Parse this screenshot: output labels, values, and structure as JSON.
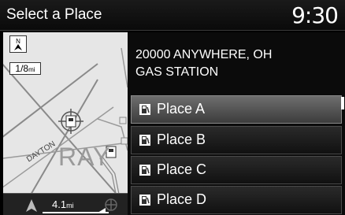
{
  "header": {
    "title": "Select a Place",
    "clock": "9:30"
  },
  "map": {
    "scale_value": "1/8",
    "scale_unit": "mi",
    "distance_value": "4.1",
    "distance_unit": "mi",
    "road_label": "DAYTON",
    "map_watermark": "RAY"
  },
  "selection": {
    "address_line1": "20000 ANYWHERE, OH",
    "address_line2": "GAS STATION"
  },
  "places": [
    {
      "label": "Place A",
      "icon": "gas-station-icon",
      "selected": true
    },
    {
      "label": "Place B",
      "icon": "gas-station-icon",
      "selected": false
    },
    {
      "label": "Place C",
      "icon": "gas-station-icon",
      "selected": false
    },
    {
      "label": "Place D",
      "icon": "gas-station-icon",
      "selected": false
    }
  ]
}
